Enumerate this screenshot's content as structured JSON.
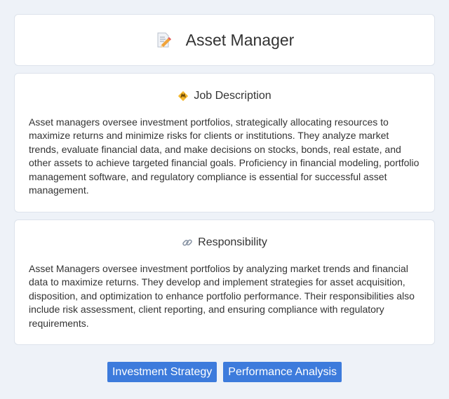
{
  "header": {
    "title": "Asset Manager",
    "icon": "memo-pencil-icon"
  },
  "job_description": {
    "title": "Job Description",
    "icon": "diamond-badge-icon",
    "text": "Asset managers oversee investment portfolios, strategically allocating resources to maximize returns and minimize risks for clients or institutions. They analyze market trends, evaluate financial data, and make decisions on stocks, bonds, real estate, and other assets to achieve targeted financial goals. Proficiency in financial modeling, portfolio management software, and regulatory compliance is essential for successful asset management."
  },
  "responsibility": {
    "title": "Responsibility",
    "icon": "link-icon",
    "text": "Asset Managers oversee investment portfolios by analyzing market trends and financial data to maximize returns. They develop and implement strategies for asset acquisition, disposition, and optimization to enhance portfolio performance. Their responsibilities also include risk assessment, client reporting, and ensuring compliance with regulatory requirements."
  },
  "tags": [
    {
      "label": "Investment Strategy"
    },
    {
      "label": "Performance Analysis"
    }
  ],
  "colors": {
    "background": "#eef2f8",
    "tag": "#3d7bdc",
    "card": "#ffffff"
  }
}
